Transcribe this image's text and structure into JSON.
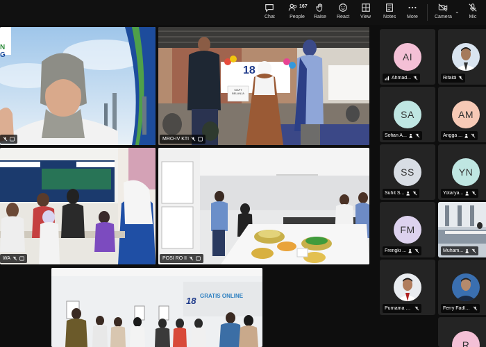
{
  "toolbar": {
    "chat": "Chat",
    "people": "People",
    "people_count": "167",
    "raise": "Raise",
    "react": "React",
    "view": "View",
    "notes": "Notes",
    "more": "More",
    "camera": "Camera",
    "mic": "Mic"
  },
  "tiles": {
    "t1": {
      "label": "",
      "banner_text": "N\nG"
    },
    "t2": {
      "label": "MRO-IV KTI",
      "banner": "18",
      "sign": "SIAPT BELANJA"
    },
    "t3": {
      "label": "WA"
    },
    "t4": {
      "label": "POSI RO II"
    },
    "t5": {
      "banner_num": "18",
      "banner_text": "GRATIS ONLINE"
    }
  },
  "participants": [
    {
      "initials": "AI",
      "name": "Ahmad...",
      "color": "#f4c0d6"
    },
    {
      "initials": "",
      "name": "Rifaldi",
      "photo": true
    },
    {
      "initials": "SA",
      "name": "Sofian A...",
      "color": "#bfe6e2"
    },
    {
      "initials": "AM",
      "name": "Angga ...",
      "color": "#f6c9b6"
    },
    {
      "initials": "SS",
      "name": "Suhit S...",
      "color": "#d8dde4"
    },
    {
      "initials": "YN",
      "name": "Yotarya...",
      "color": "#bfe6e2"
    },
    {
      "initials": "FM",
      "name": "Frengki ...",
      "color": "#ddd2ee"
    },
    {
      "initials": "",
      "name": "Muham...",
      "room": true
    },
    {
      "initials": "",
      "name": "Purnama H...",
      "photo": true
    },
    {
      "initials": "",
      "name": "Ferry Fadli ...",
      "photo": true
    },
    {
      "initials": "R",
      "name": "",
      "color": "#f4c0d6"
    }
  ],
  "colors": {
    "background": "#0e0e0e",
    "tile_bg": "#242424"
  }
}
